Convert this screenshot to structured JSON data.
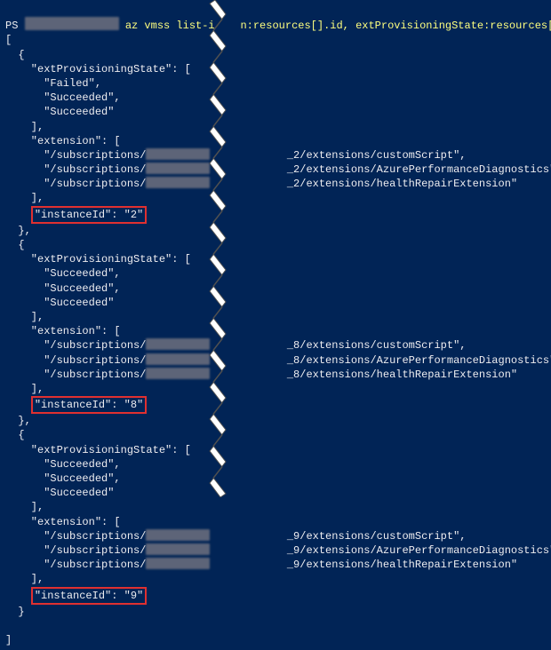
{
  "prompt": {
    "prefix": "PS ",
    "command_prefix": "az vmss list-i",
    "command_suffix": "n:resources[].id, extProvisioningState:resources[]"
  },
  "open_bracket": "[",
  "close_bracket": "]",
  "instances": [
    {
      "states": [
        "Failed",
        "Succeeded",
        "Succeeded"
      ],
      "ext_suffix_id": "2",
      "extensions": [
        "customScript",
        "AzurePerformanceDiagnostics",
        "healthRepairExtension"
      ],
      "instance_id": "2"
    },
    {
      "states": [
        "Succeeded",
        "Succeeded",
        "Succeeded"
      ],
      "ext_suffix_id": "8",
      "extensions": [
        "customScript",
        "AzurePerformanceDiagnostics",
        "healthRepairExtension"
      ],
      "instance_id": "8"
    },
    {
      "states": [
        "Succeeded",
        "Succeeded",
        "Succeeded"
      ],
      "ext_suffix_id": "9",
      "extensions": [
        "customScript",
        "AzurePerformanceDiagnostics",
        "healthRepairExtension"
      ],
      "instance_id": "9"
    }
  ],
  "labels": {
    "extProvisioningState": "extProvisioningState",
    "extension": "extension",
    "instanceId": "instanceId",
    "subscriptions": "/subscriptions/",
    "extensions_path": "/extensions/"
  }
}
